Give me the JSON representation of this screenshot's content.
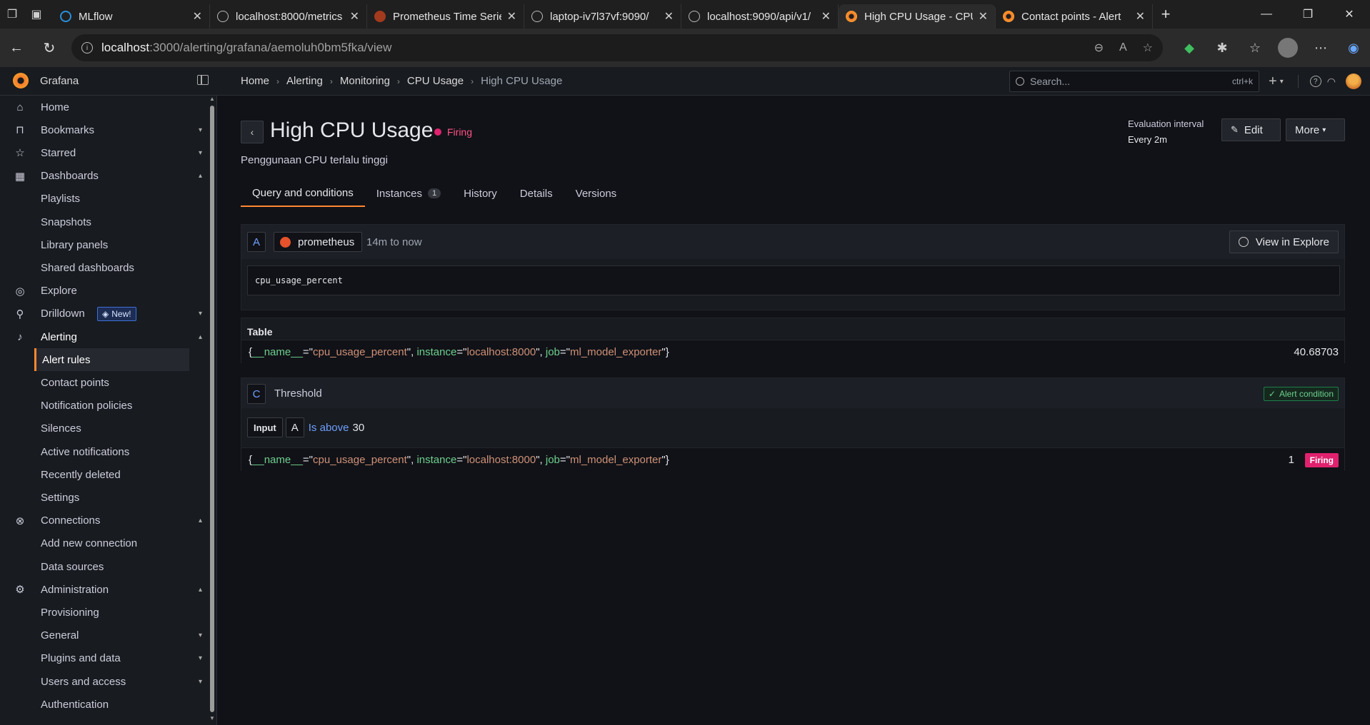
{
  "browser": {
    "tabs": [
      {
        "title": "MLflow",
        "fav": "mlflow"
      },
      {
        "title": "localhost:8000/metrics",
        "fav": "globe"
      },
      {
        "title": "Prometheus Time Series",
        "fav": "prom"
      },
      {
        "title": "laptop-iv7l37vf:9090/",
        "fav": "globe"
      },
      {
        "title": "localhost:9090/api/v1/",
        "fav": "globe"
      },
      {
        "title": "High CPU Usage - CPU",
        "fav": "grafana",
        "active": true
      },
      {
        "title": "Contact points - Alert",
        "fav": "grafana"
      }
    ],
    "url_host": "localhost",
    "url_path": ":3000/alerting/grafana/aemoluh0bm5fka/view"
  },
  "grafana": {
    "app_name": "Grafana",
    "breadcrumbs": [
      "Home",
      "Alerting",
      "Monitoring",
      "CPU Usage",
      "High CPU Usage"
    ],
    "search_placeholder": "Search...",
    "search_shortcut": "ctrl+k"
  },
  "sidebar": {
    "items": [
      {
        "label": "Home",
        "icon": "home-icon",
        "level": 0
      },
      {
        "label": "Bookmarks",
        "icon": "bookmark-icon",
        "level": 0,
        "chevron": "down"
      },
      {
        "label": "Starred",
        "icon": "star-icon",
        "level": 0,
        "chevron": "down"
      },
      {
        "label": "Dashboards",
        "icon": "dashboards-icon",
        "level": 0,
        "chevron": "up"
      },
      {
        "label": "Playlists",
        "level": 1
      },
      {
        "label": "Snapshots",
        "level": 1
      },
      {
        "label": "Library panels",
        "level": 1
      },
      {
        "label": "Shared dashboards",
        "level": 1
      },
      {
        "label": "Explore",
        "icon": "compass-icon",
        "level": 0
      },
      {
        "label": "Drilldown",
        "icon": "drilldown-icon",
        "level": 0,
        "chevron": "down",
        "badge": "New!"
      },
      {
        "label": "Alerting",
        "icon": "bell-icon",
        "level": 0,
        "chevron": "up",
        "active_parent": true
      },
      {
        "label": "Alert rules",
        "level": 1,
        "selected": true
      },
      {
        "label": "Contact points",
        "level": 1
      },
      {
        "label": "Notification policies",
        "level": 1
      },
      {
        "label": "Silences",
        "level": 1
      },
      {
        "label": "Active notifications",
        "level": 1
      },
      {
        "label": "Recently deleted",
        "level": 1
      },
      {
        "label": "Settings",
        "level": 1
      },
      {
        "label": "Connections",
        "icon": "connections-icon",
        "level": 0,
        "chevron": "up"
      },
      {
        "label": "Add new connection",
        "level": 1
      },
      {
        "label": "Data sources",
        "level": 1
      },
      {
        "label": "Administration",
        "icon": "gear-icon",
        "level": 0,
        "chevron": "up"
      },
      {
        "label": "Provisioning",
        "level": 1
      },
      {
        "label": "General",
        "level": 1,
        "chevron": "down"
      },
      {
        "label": "Plugins and data",
        "level": 1,
        "chevron": "down"
      },
      {
        "label": "Users and access",
        "level": 1,
        "chevron": "down"
      },
      {
        "label": "Authentication",
        "level": 1
      }
    ]
  },
  "rule": {
    "title": "High CPU Usage",
    "state": "Firing",
    "summary": "Penggunaan CPU terlalu tinggi",
    "eval_label": "Evaluation interval",
    "eval_value": "Every 2m",
    "edit_label": "Edit",
    "more_label": "More"
  },
  "tabs": [
    {
      "label": "Query and conditions",
      "active": true
    },
    {
      "label": "Instances",
      "count": "1"
    },
    {
      "label": "History"
    },
    {
      "label": "Details"
    },
    {
      "label": "Versions"
    }
  ],
  "query": {
    "ref_id": "A",
    "datasource": "prometheus",
    "time_range": "14m to now",
    "explore_label": "View in Explore",
    "expr": "cpu_usage_percent"
  },
  "table": {
    "title": "Table",
    "series": {
      "name_key": "__name__",
      "name_val": "cpu_usage_percent",
      "instance_key": "instance",
      "instance_val": "localhost:8000",
      "job_key": "job",
      "job_val": "ml_model_exporter"
    },
    "value": "40.68703"
  },
  "condition": {
    "ref_id": "C",
    "name": "Threshold",
    "badge": "Alert condition",
    "input_label": "Input",
    "input_ref": "A",
    "operator": "Is above",
    "threshold": "30",
    "result_value": "1",
    "result_state": "Firing"
  }
}
